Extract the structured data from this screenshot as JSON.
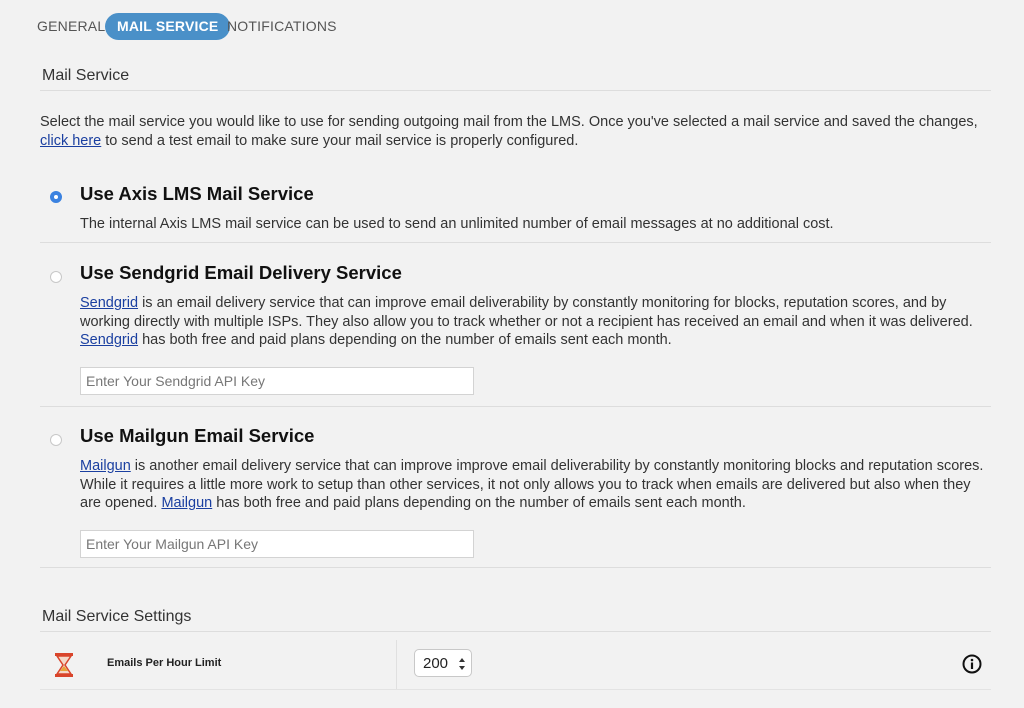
{
  "tabs": [
    {
      "label": "GENERAL",
      "active": false
    },
    {
      "label": "MAIL SERVICE",
      "active": true
    },
    {
      "label": "NOTIFICATIONS",
      "active": false
    }
  ],
  "mail_service": {
    "heading": "Mail Service",
    "intro_before": "Select the mail service you would like to use for sending outgoing mail from the LMS. Once you've selected a mail service and saved the changes, ",
    "intro_link": "click here",
    "intro_after": " to send a test email to make sure your mail service is properly configured.",
    "options": [
      {
        "title": "Use Axis LMS Mail Service",
        "selected": true,
        "description": "The internal Axis LMS mail service can be used to send an unlimited number of email messages at no additional cost."
      },
      {
        "title": "Use Sendgrid Email Delivery Service",
        "selected": false,
        "link1": "Sendgrid",
        "desc_part1": " is an email delivery service that can improve email deliverability by constantly monitoring for blocks, reputation scores, and by working directly with multiple ISPs. They also allow you to track whether or not a recipient has received an email and when it was delivered. ",
        "link2": "Sendgrid",
        "desc_part2": " has both free and paid plans depending on the number of emails sent each month.",
        "input_placeholder": "Enter Your Sendgrid API Key",
        "input_value": ""
      },
      {
        "title": "Use Mailgun Email Service",
        "selected": false,
        "link1": "Mailgun",
        "desc_part1": " is another email delivery service that can improve improve email deliverability by constantly monitoring blocks and reputation scores. While it requires a little more work to setup than other services, it not only allows you to track when emails are delivered but also when they are opened. ",
        "link2": "Mailgun",
        "desc_part2": " has both free and paid plans depending on the number of emails sent each month.",
        "input_placeholder": "Enter Your Mailgun API Key",
        "input_value": ""
      }
    ]
  },
  "settings": {
    "heading": "Mail Service Settings",
    "rows": [
      {
        "label": "Emails Per Hour Limit",
        "value": "200",
        "icon": "hourglass-icon",
        "info_icon": "info-icon"
      }
    ]
  },
  "colors": {
    "accent": "#4a90c8",
    "radio_selected": "#3b82e0",
    "link": "#1a3fa0",
    "hourglass": "#d9452b"
  }
}
